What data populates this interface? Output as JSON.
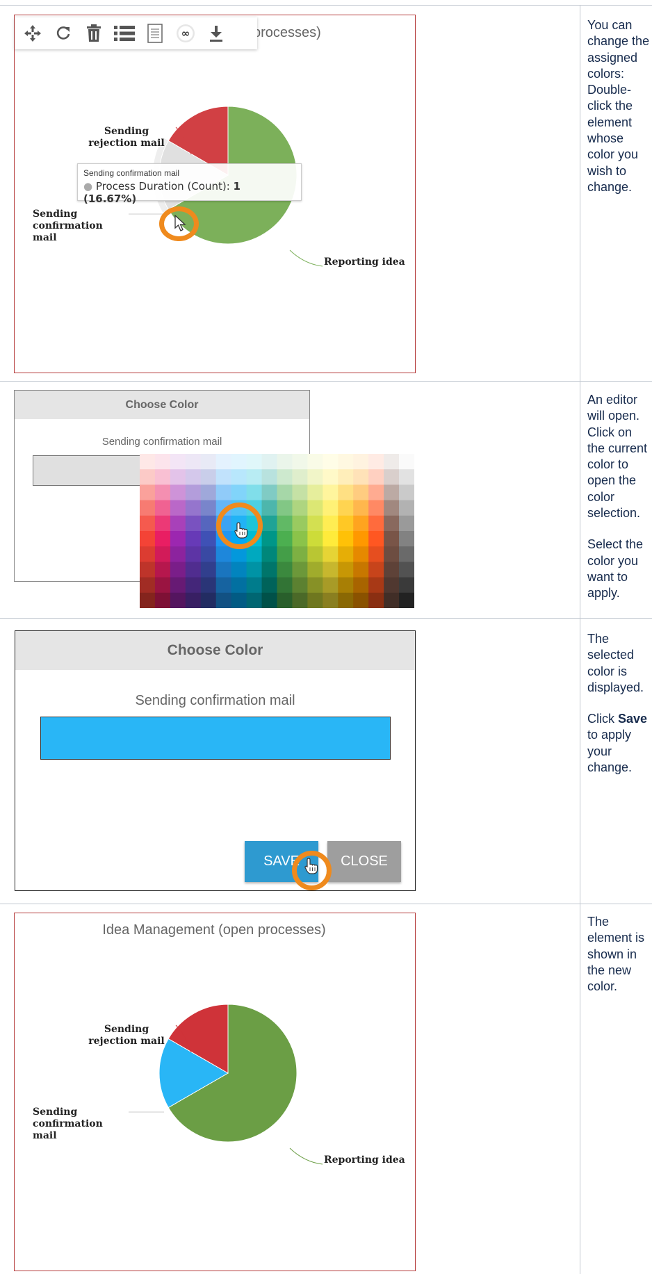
{
  "rows": [
    {
      "description": [
        "You can change the assigned colors: Double-click the element whose color you wish to change."
      ],
      "chart": {
        "title_partial": "processes)",
        "toolbar_icons": [
          "move-icon",
          "refresh-icon",
          "trash-icon",
          "list-icon",
          "document-icon",
          "infinity-icon",
          "download-icon"
        ],
        "labels": {
          "rejection": "Sending rejection mail",
          "confirmation": "Sending confirmation mail",
          "reporting": "Reporting idea"
        },
        "tooltip": {
          "title": "Sending confirmation mail",
          "series": "Process Duration (Count):",
          "value": "1 (16.67%)"
        }
      }
    },
    {
      "description": [
        "An editor will open. Click on the current color to open the color selection.",
        "Select the color you want to apply."
      ],
      "dialog": {
        "header": "Choose Color",
        "subtitle": "Sending confirmation mail"
      }
    },
    {
      "description_parts": [
        "The selected color is displayed.",
        "Click ",
        "Save",
        " to apply your change."
      ],
      "dialog": {
        "header": "Choose Color",
        "subtitle": "Sending confirmation mail",
        "save_label": "SAVE",
        "close_label": "CLOSE",
        "selected_color": "#29b6f6"
      }
    },
    {
      "description": [
        "The element is shown in the new color."
      ],
      "chart": {
        "title": "Idea Management (open processes)",
        "labels": {
          "rejection": "Sending rejection mail",
          "confirmation": "Sending confirmation mail",
          "reporting": "Reporting idea"
        }
      }
    }
  ],
  "chart_data": {
    "type": "pie",
    "categories": [
      "Reporting idea",
      "Sending confirmation mail",
      "Sending rejection mail"
    ],
    "values": [
      4,
      1,
      1
    ],
    "colors_before": [
      "#7cb05a",
      "#e0e0e0",
      "#d14044"
    ],
    "colors_after": [
      "#6b9e45",
      "#29b6f6",
      "#cf3339"
    ]
  },
  "colors": {
    "highlight_ring": "#ef8a1d",
    "save_button": "#2e9ad0",
    "close_button": "#9e9e9e",
    "border": "#c1c7d0"
  }
}
